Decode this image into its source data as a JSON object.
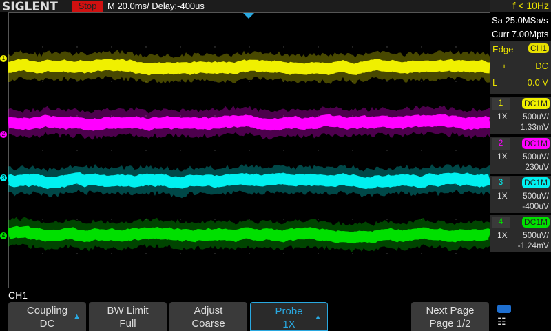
{
  "header": {
    "logo": "SIGLENT",
    "run_state": "Stop",
    "timebase": "M 20.0ms/ Delay:-400us"
  },
  "status": {
    "frequency": "f < 10Hz",
    "sample_rate": "Sa 25.0MSa/s",
    "memory_depth": "Curr 7.00Mpts"
  },
  "trigger": {
    "type": "Edge",
    "source": "CH1",
    "slope_icon": "rising-edge-icon",
    "coupling": "DC",
    "level_label": "L",
    "level": "0.0 V"
  },
  "channels": [
    {
      "num": "1",
      "coupling": "DC1M",
      "probe": "1X",
      "scale": "500uV/",
      "offset": "1.33mV",
      "color": "#f0f000"
    },
    {
      "num": "2",
      "coupling": "DC1M",
      "probe": "1X",
      "scale": "500uV/",
      "offset": "230uV",
      "color": "#ff00ff"
    },
    {
      "num": "3",
      "coupling": "DC1M",
      "probe": "1X",
      "scale": "500uV/",
      "offset": "-400uV",
      "color": "#00f0f0"
    },
    {
      "num": "4",
      "coupling": "DC1M",
      "probe": "1X",
      "scale": "500uV/",
      "offset": "-1.24mV",
      "color": "#00e000"
    }
  ],
  "menu": {
    "title": "CH1",
    "keys": [
      {
        "top": "Coupling",
        "bottom": "DC"
      },
      {
        "top": "BW Limit",
        "bottom": "Full"
      },
      {
        "top": "Adjust",
        "bottom": "Coarse"
      },
      {
        "top": "Probe",
        "bottom": "1X"
      },
      {
        "top": "Next Page",
        "bottom": "Page 1/2"
      }
    ]
  }
}
